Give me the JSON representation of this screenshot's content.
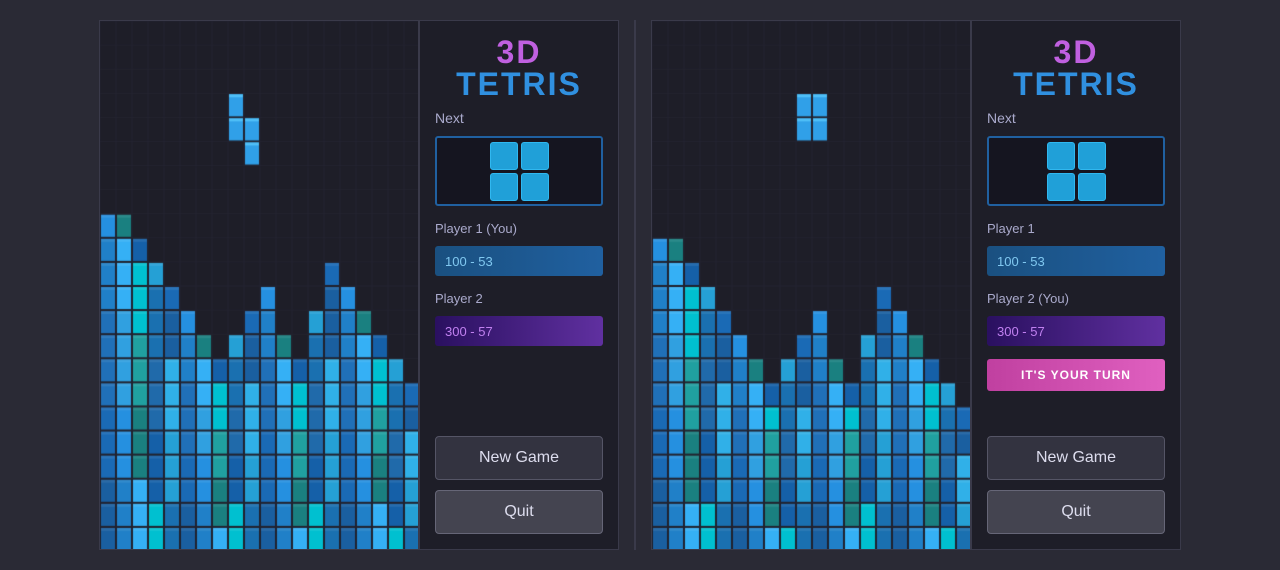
{
  "instance1": {
    "title_3d": "3D",
    "title_tetris": "TETRIS",
    "next_label": "Next",
    "player1_label": "Player 1 (You)",
    "player1_score": "100 - 53",
    "player2_label": "Player 2",
    "player2_score": "300 - 57",
    "new_game_label": "New Game",
    "quit_label": "Quit",
    "show_your_turn": false
  },
  "instance2": {
    "title_3d": "3D",
    "title_tetris": "TETRIS",
    "next_label": "Next",
    "player1_label": "Player 1",
    "player1_score": "100 - 53",
    "player2_label": "Player 2 (You)",
    "player2_score": "300 - 57",
    "your_turn_label": "IT'S YOUR TURN",
    "new_game_label": "New Game",
    "quit_label": "Quit",
    "show_your_turn": true
  }
}
